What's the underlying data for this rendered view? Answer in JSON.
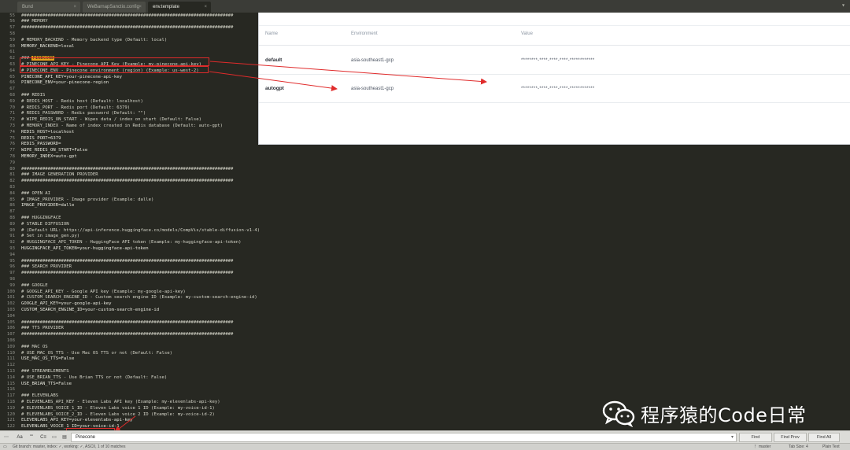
{
  "tabs": [
    {
      "label": "Bund",
      "active": false
    },
    {
      "label": "WeBarnapSanctio.config",
      "active": false
    },
    {
      "label": "env.template",
      "active": true
    }
  ],
  "code_lines": [
    {
      "n": "55",
      "t": "################################################################################"
    },
    {
      "n": "56",
      "t": "### MEMORY"
    },
    {
      "n": "57",
      "t": "################################################################################"
    },
    {
      "n": "58",
      "t": ""
    },
    {
      "n": "59",
      "t": "# MEMORY_BACKEND - Memory backend type (Default: local)"
    },
    {
      "n": "60",
      "t": "MEMORY_BACKEND=local"
    },
    {
      "n": "61",
      "t": ""
    },
    {
      "n": "62",
      "t": "### PINECONE"
    },
    {
      "n": "63",
      "t": "# PINECONE_API_KEY - Pinecone API Key (Example: my-pinecone-api-key)"
    },
    {
      "n": "64",
      "t": "# PINECONE_ENV - Pinecone environment (region) (Example: us-west-2)"
    },
    {
      "n": "65",
      "t": "PINECONE_API_KEY=your-pinecone-api-key"
    },
    {
      "n": "66",
      "t": "PINECONE_ENV=your-pinecone-region"
    },
    {
      "n": "67",
      "t": ""
    },
    {
      "n": "68",
      "t": "### REDIS"
    },
    {
      "n": "69",
      "t": "# REDIS_HOST - Redis host (Default: localhost)"
    },
    {
      "n": "70",
      "t": "# REDIS_PORT - Redis port (Default: 6379)"
    },
    {
      "n": "71",
      "t": "# REDIS_PASSWORD - Redis password (Default: \"\")"
    },
    {
      "n": "72",
      "t": "# WIPE_REDIS_ON_START - Wipes data / index on start (Default: False)"
    },
    {
      "n": "73",
      "t": "# MEMORY_INDEX - Name of index created in Redis database (Default: auto-gpt)"
    },
    {
      "n": "74",
      "t": "REDIS_HOST=localhost"
    },
    {
      "n": "75",
      "t": "REDIS_PORT=6379"
    },
    {
      "n": "76",
      "t": "REDIS_PASSWORD="
    },
    {
      "n": "77",
      "t": "WIPE_REDIS_ON_START=False"
    },
    {
      "n": "78",
      "t": "MEMORY_INDEX=auto-gpt"
    },
    {
      "n": "79",
      "t": ""
    },
    {
      "n": "80",
      "t": "################################################################################"
    },
    {
      "n": "81",
      "t": "### IMAGE GENERATION PROVIDER"
    },
    {
      "n": "82",
      "t": "################################################################################"
    },
    {
      "n": "83",
      "t": ""
    },
    {
      "n": "84",
      "t": "### OPEN AI"
    },
    {
      "n": "85",
      "t": "# IMAGE_PROVIDER - Image provider (Example: dalle)"
    },
    {
      "n": "86",
      "t": "IMAGE_PROVIDER=dalle"
    },
    {
      "n": "87",
      "t": ""
    },
    {
      "n": "88",
      "t": "### HUGGINGFACE"
    },
    {
      "n": "89",
      "t": "# STABLE DIFFUSION"
    },
    {
      "n": "90",
      "t": "# (Default URL: https://api-inference.huggingface.co/models/CompVis/stable-diffusion-v1-4)"
    },
    {
      "n": "91",
      "t": "# Set in image_gen.py)"
    },
    {
      "n": "92",
      "t": "# HUGGINGFACE_API_TOKEN - HuggingFace API token (Example: my-huggingface-api-token)"
    },
    {
      "n": "93",
      "t": "HUGGINGFACE_API_TOKEN=your-huggingface-api-token"
    },
    {
      "n": "94",
      "t": ""
    },
    {
      "n": "95",
      "t": "################################################################################"
    },
    {
      "n": "96",
      "t": "### SEARCH PROVIDER"
    },
    {
      "n": "97",
      "t": "################################################################################"
    },
    {
      "n": "98",
      "t": ""
    },
    {
      "n": "99",
      "t": "### GOOGLE"
    },
    {
      "n": "100",
      "t": "# GOOGLE_API_KEY - Google API key (Example: my-google-api-key)"
    },
    {
      "n": "101",
      "t": "# CUSTOM_SEARCH_ENGINE_ID - Custom search engine ID (Example: my-custom-search-engine-id)"
    },
    {
      "n": "102",
      "t": "GOOGLE_API_KEY=your-google-api-key"
    },
    {
      "n": "103",
      "t": "CUSTOM_SEARCH_ENGINE_ID=your-custom-search-engine-id"
    },
    {
      "n": "104",
      "t": ""
    },
    {
      "n": "105",
      "t": "################################################################################"
    },
    {
      "n": "106",
      "t": "### TTS PROVIDER"
    },
    {
      "n": "107",
      "t": "################################################################################"
    },
    {
      "n": "108",
      "t": ""
    },
    {
      "n": "109",
      "t": "### MAC OS"
    },
    {
      "n": "110",
      "t": "# USE_MAC_OS_TTS - Use Mac OS TTS or not (Default: False)"
    },
    {
      "n": "111",
      "t": "USE_MAC_OS_TTS=False"
    },
    {
      "n": "112",
      "t": ""
    },
    {
      "n": "113",
      "t": "### STREAMELEMENTS"
    },
    {
      "n": "114",
      "t": "# USE_BRIAN_TTS - Use Brian TTS or not (Default: False)"
    },
    {
      "n": "115",
      "t": "USE_BRIAN_TTS=False"
    },
    {
      "n": "116",
      "t": ""
    },
    {
      "n": "117",
      "t": "### ELEVENLABS"
    },
    {
      "n": "118",
      "t": "# ELEVENLABS_API_KEY - Eleven Labs API key (Example: my-elevenlabs-api-key)"
    },
    {
      "n": "119",
      "t": "# ELEVENLABS_VOICE_1_ID - Eleven Labs voice 1 ID (Example: my-voice-id-1)"
    },
    {
      "n": "120",
      "t": "# ELEVENLABS_VOICE_2_ID - Eleven Labs voice 2 ID (Example: my-voice-id-2)"
    },
    {
      "n": "121",
      "t": "ELEVENLABS_API_KEY=your-elevenlabs-api-key"
    },
    {
      "n": "122",
      "t": "ELEVENLABS_VOICE_1_ID=your-voice-id-1"
    },
    {
      "n": "123",
      "t": "ELEVENLABS_VOICE_2_ID=your-voice-id-2"
    },
    {
      "n": "124",
      "t": ""
    }
  ],
  "highlight_word": "PINECONE",
  "panel": {
    "headers": {
      "name": "Name",
      "environment": "Environment",
      "value": "Value"
    },
    "rows": [
      {
        "name": "default",
        "environment": "asia-southeast1-gcp",
        "value": "********-****-****-****-************"
      },
      {
        "name": "autogpt",
        "environment": "asia-southeast1-gcp",
        "value": "********-****-****-****-************"
      }
    ]
  },
  "findbar": {
    "aa": "Aa",
    "word": "\"\"",
    "regex": "C≡",
    "query": "Pinecone",
    "find": "Find",
    "find_prev": "Find Prev",
    "find_all": "Find All"
  },
  "statusbar": {
    "left": "Git branch: master, index: ✓, working: ✓, ASCII, 1 of 10 matches",
    "branch": "master",
    "tab_size": "Tab Size: 4",
    "syntax": "Plain Text"
  },
  "watermark": {
    "text": "程序猿的Code日常"
  },
  "colors": {
    "annotation": "#e02b2b",
    "highlight": "#e6a21a",
    "editor_bg": "#272822"
  }
}
